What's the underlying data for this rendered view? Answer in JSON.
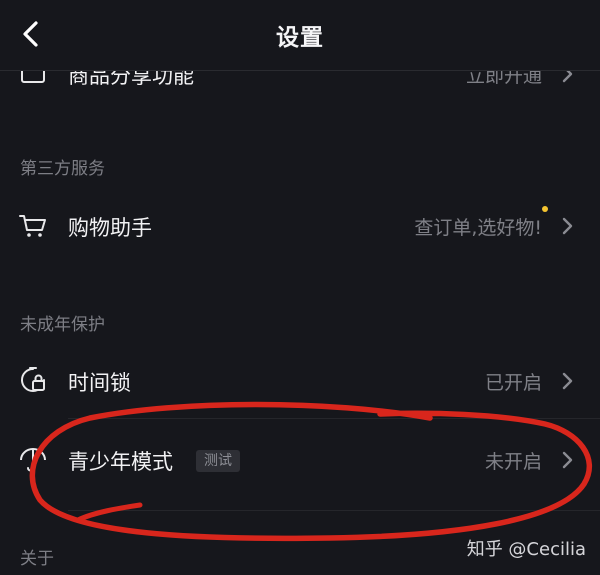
{
  "header": {
    "title": "设置"
  },
  "clipped_row": {
    "label": "商品分享功能",
    "value": "立即开通"
  },
  "sections": {
    "third_party": {
      "title": "第三方服务",
      "shopping": {
        "label": "购物助手",
        "value": "查订单,选好物!"
      }
    },
    "minor_protection": {
      "title": "未成年保护",
      "time_lock": {
        "label": "时间锁",
        "value": "已开启"
      },
      "youth_mode": {
        "label": "青少年模式",
        "badge": "测试",
        "value": "未开启"
      }
    },
    "about": {
      "title": "关于"
    }
  },
  "watermark": "知乎 @Cecilia",
  "colors": {
    "background": "#16171c",
    "annotation": "#d8261c",
    "notification_dot": "#f4c430"
  }
}
